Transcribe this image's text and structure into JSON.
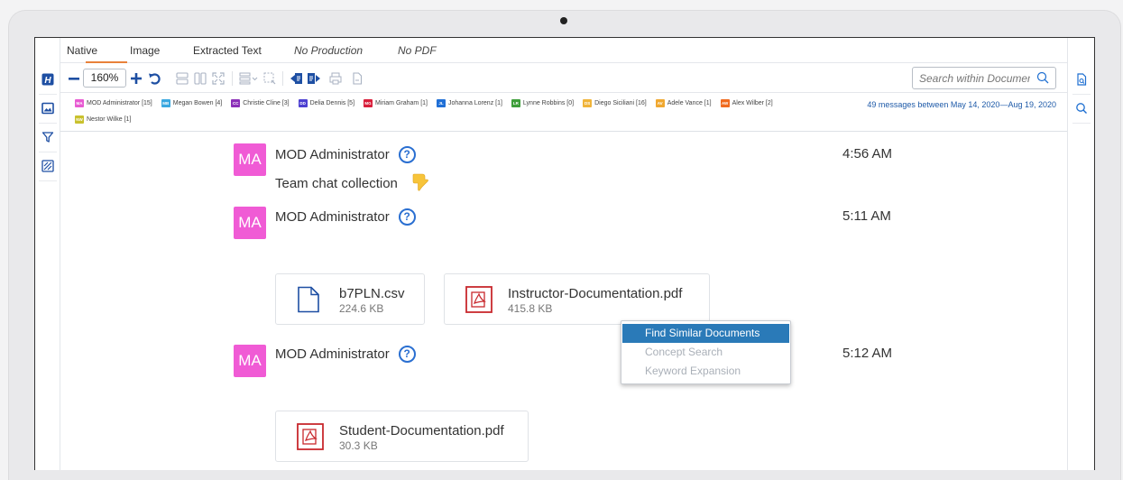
{
  "tabs": [
    {
      "label": "Native",
      "italic": false
    },
    {
      "label": "Image",
      "italic": false
    },
    {
      "label": "Extracted Text",
      "italic": false
    },
    {
      "label": "No Production",
      "italic": true
    },
    {
      "label": "No PDF",
      "italic": true
    }
  ],
  "active_tab": "Native",
  "toolbar": {
    "zoom": "160%",
    "search_placeholder": "Search within Document"
  },
  "participants": [
    {
      "initials": "MA",
      "name": "MOD Administrator [15]",
      "color": "#e85bd2"
    },
    {
      "initials": "MB",
      "name": "Megan Bowen [4]",
      "color": "#3aa8e0"
    },
    {
      "initials": "CC",
      "name": "Christie Cline [3]",
      "color": "#8b2fb8"
    },
    {
      "initials": "DD",
      "name": "Delia Dennis [5]",
      "color": "#4c3fd1"
    },
    {
      "initials": "MG",
      "name": "Miriam Graham [1]",
      "color": "#d81e3a"
    },
    {
      "initials": "JL",
      "name": "Johanna Lorenz [1]",
      "color": "#1f6fd6"
    },
    {
      "initials": "LR",
      "name": "Lynne Robbins [0]",
      "color": "#3e9e3a"
    },
    {
      "initials": "DS",
      "name": "Diego Siciliani [16]",
      "color": "#f0b43a"
    },
    {
      "initials": "AV",
      "name": "Adele Vance [1]",
      "color": "#f0a830"
    },
    {
      "initials": "AW",
      "name": "Alex Wilber [2]",
      "color": "#f06a1e"
    },
    {
      "initials": "NW",
      "name": "Nestor Wilke [1]",
      "color": "#c9c12e"
    }
  ],
  "message_count": "49 messages between May 14, 2020—Aug 19, 2020",
  "messages": [
    {
      "avatar": "MA",
      "author": "MOD Administrator",
      "time": "4:56 AM",
      "text": "Team chat collection"
    },
    {
      "avatar": "MA",
      "author": "MOD Administrator",
      "time": "5:11 AM"
    },
    {
      "avatar": "MA",
      "author": "MOD Administrator",
      "time": "5:12 AM"
    }
  ],
  "help_glyph": "?",
  "attachments": [
    {
      "name": "b7PLN.csv",
      "size": "224.6 KB",
      "icon": "document-icon"
    },
    {
      "name": "Instructor-Documentation.pdf",
      "size": "415.8 KB",
      "icon": "pdf-icon"
    },
    {
      "name": "Student-Documentation.pdf",
      "size": "30.3 KB",
      "icon": "pdf-icon"
    }
  ],
  "context_menu": [
    {
      "label": "Find Similar Documents",
      "state": "active"
    },
    {
      "label": "Concept Search",
      "state": "disabled"
    },
    {
      "label": "Keyword Expansion",
      "state": "disabled"
    }
  ],
  "colors": {
    "accent": "#e8813a",
    "brand_blue": "#1e4fa3",
    "avatar": "#f05bd5",
    "menu_highlight": "#2a7ab8"
  }
}
